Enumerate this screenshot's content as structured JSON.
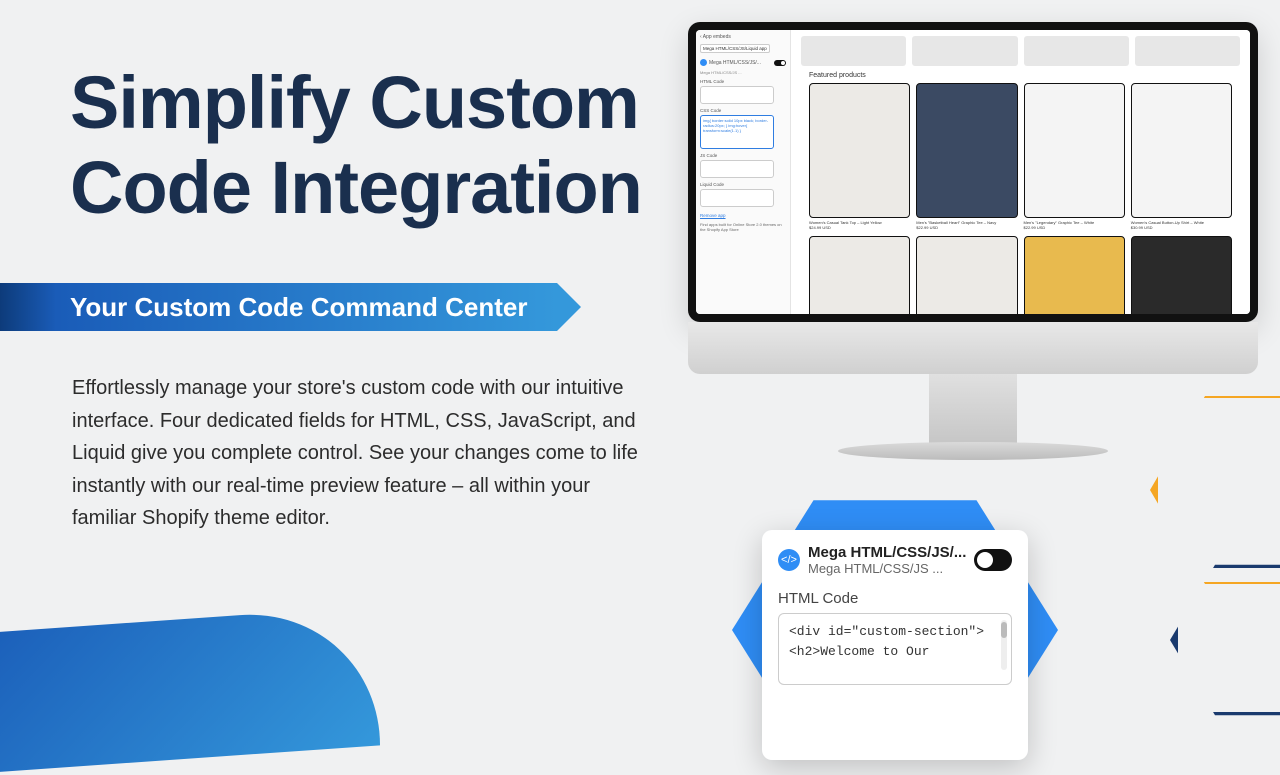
{
  "heading_line1": "Simplify Custom",
  "heading_line2": "Code Integration",
  "subtitle": "Your Custom Code Command Center",
  "body": "Effortlessly manage your store's custom code with our intuitive interface. Four dedicated fields for HTML, CSS, JavaScript, and Liquid give you complete control. See your changes come to life instantly with our real-time preview feature – all within your familiar Shopify theme editor.",
  "editor": {
    "crumb": "App embeds",
    "app_pill": "Mega HTML/CSS/JS/Liquid app",
    "app_title": "Mega HTML/CSS/JS/...",
    "app_sub": "Mega HTML/CSS/JS ...",
    "html_label": "HTML Code",
    "css_label": "CSS Code",
    "css_sample": "img{\nborder:solid 10px black;\nborder-radius:20px;\n}\nimg:hover{\ntransform:scale(1.1)\n}",
    "js_label": "JS Code",
    "liquid_label": "Liquid Code",
    "remove_link": "Remove app",
    "footer": "Find apps built for Online Store 2.0 themes on the Shopify App Store"
  },
  "preview": {
    "section_title": "Featured products",
    "products": [
      {
        "name": "Women's Casual Tank Top – Light Yellow",
        "price": "$24.99 USD"
      },
      {
        "name": "Men's \"Basketball Heart\" Graphic Tee – Navy",
        "price": "$22.99 USD"
      },
      {
        "name": "Men's \"Legendary\" Graphic Tee – White",
        "price": "$22.99 USD"
      },
      {
        "name": "Women's Casual Button-Up Shirt – White",
        "price": "$30.99 USD"
      }
    ]
  },
  "popup": {
    "title1": "Mega HTML/CSS/JS/...",
    "title2": "Mega HTML/CSS/JS ...",
    "label": "HTML Code",
    "code_line1": "<div id=\"custom-section\">",
    "code_line2": "  <h2>Welcome to Our"
  }
}
